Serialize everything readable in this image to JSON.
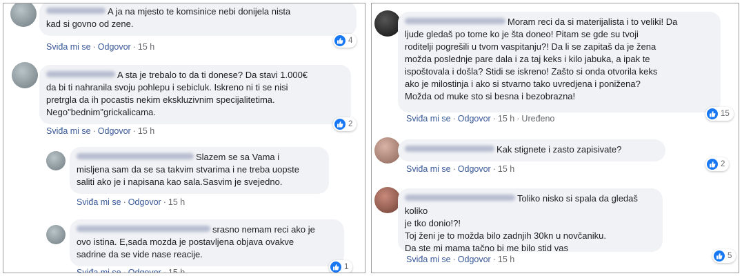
{
  "ui": {
    "like": "Sviđa mi se",
    "reply": "Odgovor",
    "dot": "·",
    "edited": "Uređeno",
    "like_color": "#1877f2",
    "reaction_icon": "like-icon"
  },
  "comments": {
    "c1": {
      "text": "A ja na mjesto te komsinice nebi donijela nista\nkad si govno od zene.",
      "time": "15 h",
      "likes": "4"
    },
    "c2": {
      "text": "A sta je trebalo to da ti donese? Da stavi 1.000€\nda bi ti nahranila svoju pohlepu i sebicluk. Iskreno ni ti se nisi\npretrgla da ih pocastis nekim ekskluzivnim specijalitetima.\nNego\"bednim\"grickalicama.",
      "time": "15 h",
      "likes": "2"
    },
    "c3": {
      "text": "Slazem se sa Vama i\nmisljena sam da se sa takvim stvarima i ne treba uopste\nsaliti ako je i napisana kao sala.Sasvim je svejedno.",
      "time": "15 h"
    },
    "c4": {
      "text": "srasno nemam reci ako je\novo istina. E,sada mozda je postavljena objava ovakve\nsadrine da se vide nase reacije.",
      "time": "15 h",
      "likes": "1"
    },
    "c5": {
      "text": "Moram reci da si materijalista i to veliki! Da\nljude gledaš po tome ko je šta doneo! Pitam se gde su tvoji\nroditelji pogrešili u tvom vaspitanju?! Da li se zapitaš da je žena\nmožda poslednje pare dala i za taj keks i kilo jabuka, a ipak te\nispoštovala i došla? Stidi se iskreno! Zašto si onda otvorila keks\nako je milostinja i ako si stvarno tako uvredjena i ponižena?\nMožda od muke sto si besna i bezobrazna!",
      "time": "15 h",
      "likes": "15"
    },
    "c6": {
      "text": "Kak stignete i zasto zapisivate?",
      "time": "15 h",
      "likes": "2"
    },
    "c7": {
      "text": "Toliko nisko si spala da gledaš koliko\nje tko donio!?!\nToj ženi je to možda bilo zadnjih 30kn u novčaniku.\nDa ste mi mama tačno bi me bilo stid vas",
      "time": "15 h",
      "likes": "5"
    }
  }
}
